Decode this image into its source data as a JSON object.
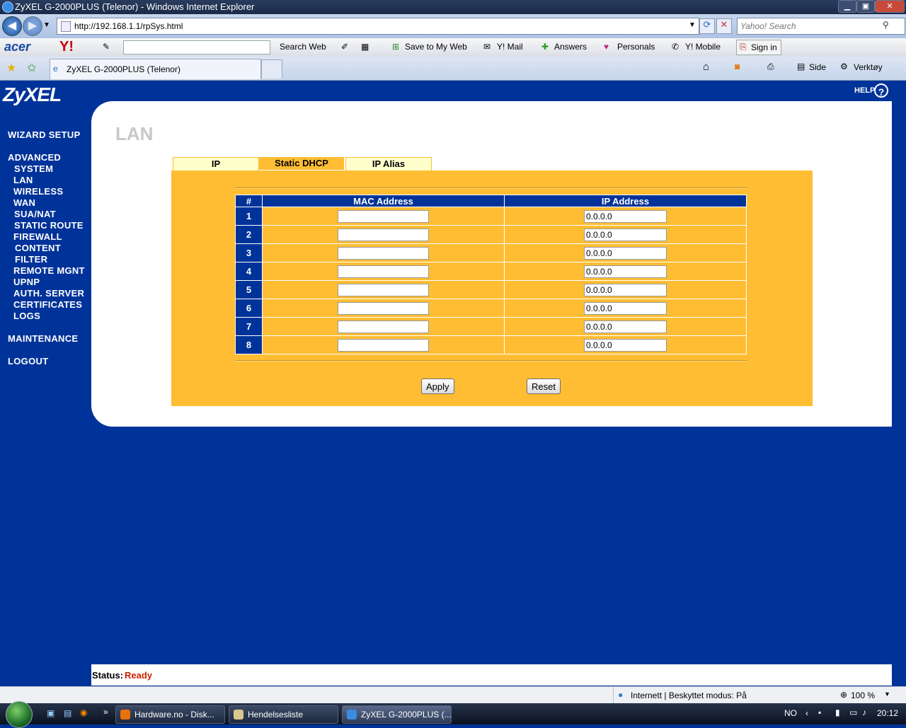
{
  "window": {
    "title": "ZyXEL G-2000PLUS (Telenor) - Windows Internet Explorer",
    "minimize": "▁",
    "maximize": "▣",
    "close": "✕"
  },
  "address_bar": {
    "url": "http://192.168.1.1/rpSys.html",
    "search_placeholder": "Yahoo! Search"
  },
  "yahoo_toolbar": {
    "acer": "acer",
    "yahoo": "Y!",
    "search_web": "Search Web",
    "save_to_my_web": "Save to My Web",
    "ymail": "Y! Mail",
    "answers": "Answers",
    "personals": "Personals",
    "ymobile": "Y! Mobile",
    "sign_in": "Sign in"
  },
  "tabs_bar": {
    "active_tab": "ZyXEL G-2000PLUS (Telenor)",
    "side": "Side",
    "verktoy": "Verktøy"
  },
  "router": {
    "logo": "ZyXEL",
    "help": "HELP",
    "help_icon": "?",
    "page_title": "LAN",
    "nav": {
      "wizard": "WIZARD SETUP",
      "advanced": "ADVANCED",
      "items": [
        "SYSTEM",
        "LAN",
        "WIRELESS",
        "WAN",
        "SUA/NAT",
        "STATIC ROUTE",
        "FIREWALL",
        "CONTENT",
        "FILTER",
        "REMOTE MGNT",
        "UPNP",
        "AUTH. SERVER",
        "CERTIFICATES",
        "LOGS"
      ],
      "maintenance": "MAINTENANCE",
      "logout": "LOGOUT"
    },
    "subtabs": {
      "ip": "IP",
      "static_dhcp": "Static DHCP",
      "ip_alias": "IP Alias"
    },
    "table": {
      "headers": [
        "#",
        "MAC Address",
        "IP Address"
      ],
      "rows": [
        {
          "num": "1",
          "mac": "",
          "ip": "0.0.0.0"
        },
        {
          "num": "2",
          "mac": "",
          "ip": "0.0.0.0"
        },
        {
          "num": "3",
          "mac": "",
          "ip": "0.0.0.0"
        },
        {
          "num": "4",
          "mac": "",
          "ip": "0.0.0.0"
        },
        {
          "num": "5",
          "mac": "",
          "ip": "0.0.0.0"
        },
        {
          "num": "6",
          "mac": "",
          "ip": "0.0.0.0"
        },
        {
          "num": "7",
          "mac": "",
          "ip": "0.0.0.0"
        },
        {
          "num": "8",
          "mac": "",
          "ip": "0.0.0.0"
        }
      ]
    },
    "buttons": {
      "apply": "Apply",
      "reset": "Reset"
    },
    "status": {
      "label": "Status:",
      "value": "Ready"
    }
  },
  "ie_status": {
    "zone": "Internett | Beskyttet modus: På",
    "zoom": "100 %"
  },
  "taskbar": {
    "tasks": [
      "Hardware.no - Disk...",
      "Hendelsesliste",
      "ZyXEL G-2000PLUS (..."
    ],
    "lang": "NO",
    "clock": "20:12"
  },
  "colors": {
    "page_bg": "#003399",
    "panel": "#ffbd33",
    "tab_inactive": "#ffffcc",
    "status_ready": "#cc2200"
  }
}
